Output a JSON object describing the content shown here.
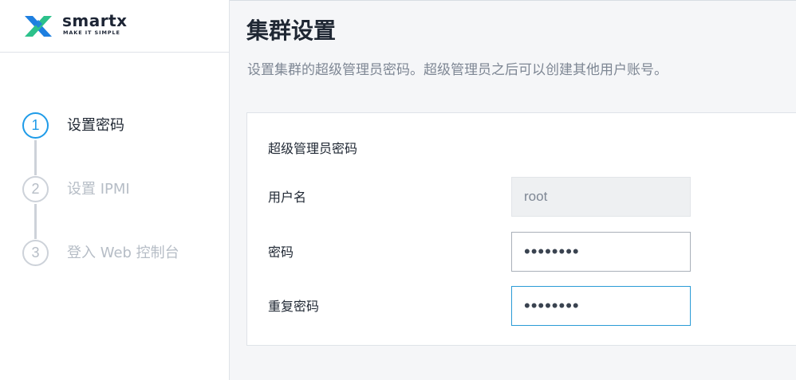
{
  "brand": {
    "name": "smartx",
    "tagline": "MAKE IT SIMPLE",
    "colors": {
      "primary": "#1e7fe0",
      "secondary": "#2cc18b"
    }
  },
  "steps": [
    {
      "number": "1",
      "label": "设置密码",
      "state": "active"
    },
    {
      "number": "2",
      "label": "设置 IPMI",
      "state": "pending"
    },
    {
      "number": "3",
      "label": "登入 Web 控制台",
      "state": "pending"
    }
  ],
  "page": {
    "title": "集群设置",
    "subtitle": "设置集群的超级管理员密码。超级管理员之后可以创建其他用户账号。"
  },
  "form": {
    "section_title": "超级管理员密码",
    "username": {
      "label": "用户名",
      "value": "root"
    },
    "password": {
      "label": "密码",
      "value": "••••••••"
    },
    "confirm_password": {
      "label": "重复密码",
      "value": "••••••••"
    }
  },
  "colors": {
    "accent": "#1e9be8",
    "step_inactive": "#cdd2d9",
    "text_muted": "#7e8794"
  }
}
